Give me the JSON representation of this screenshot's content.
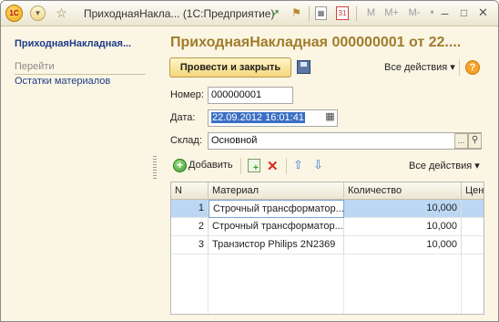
{
  "titlebar": {
    "logo": "1С",
    "title": "ПриходнаяНакла... (1С:Предприятие)",
    "memory_buttons": [
      "M",
      "M+",
      "M-"
    ]
  },
  "sidebar": {
    "title": "ПриходнаяНакладная...",
    "section": "Перейти",
    "links": [
      {
        "label": "Остатки материалов"
      }
    ]
  },
  "form": {
    "title": "ПриходнаяНакладная 000000001 от 22....",
    "post_close_label": "Провести и закрыть",
    "all_actions_label": "Все действия ▾",
    "help_label": "?",
    "number_label": "Номер:",
    "number_value": "000000001",
    "date_label": "Дата:",
    "date_value": "22.09.2012 16:01:41",
    "warehouse_label": "Склад:",
    "warehouse_value": "Основной"
  },
  "table_toolbar": {
    "add_label": "Добавить",
    "all_actions_label": "Все действия ▾"
  },
  "table": {
    "columns": [
      "N",
      "Материал",
      "Количество",
      "Цен"
    ],
    "rows": [
      {
        "n": "1",
        "material": "Строчный трансформатор...",
        "qty": "10,000",
        "active": true
      },
      {
        "n": "2",
        "material": "Строчный трансформатор...",
        "qty": "10,000",
        "active": false
      },
      {
        "n": "3",
        "material": "Транзистор Philips 2N2369",
        "qty": "10,000",
        "active": false
      }
    ]
  },
  "colors": {
    "accent_title": "#a07c2c",
    "link": "#1f3b8a",
    "selected_row": "#bcd7f3",
    "background": "#fbf6e3"
  }
}
